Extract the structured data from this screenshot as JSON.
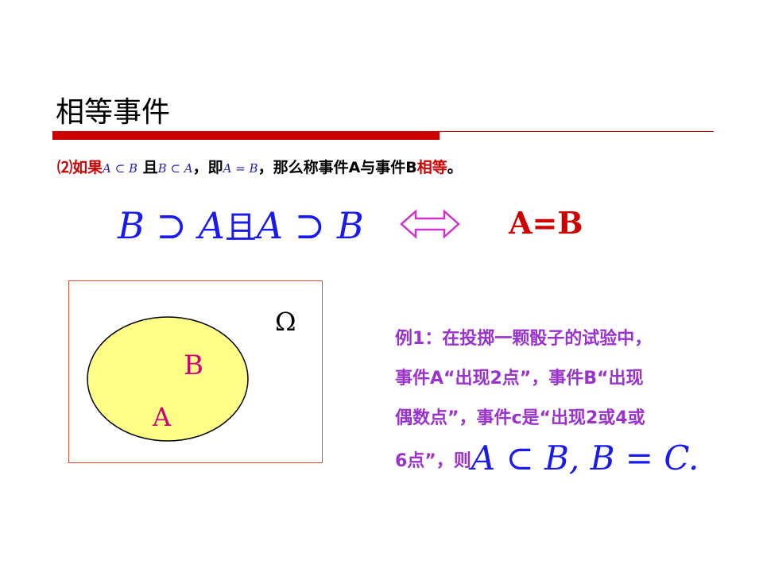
{
  "slide": {
    "title": "相等事件",
    "accent_color": "#cc0000"
  },
  "definition": {
    "prefix": "⑵如果",
    "math1": "A ⊂ B",
    "conj": " 且",
    "math2": "B ⊂ A",
    "mid": "，即",
    "math3": "A = B",
    "suffix": "，那么称事件A与事件B",
    "highlight": "相等",
    "end": "。"
  },
  "formula": {
    "left_part1": "B ⊃ A",
    "left_conj": "且",
    "left_part2": "A ⊃ B",
    "arrow_icon": "double-arrow-icon",
    "right": "A=B"
  },
  "venn": {
    "omega": "Ω",
    "label_b": "B",
    "label_a": "A",
    "fill_color": "#ffff88"
  },
  "example": {
    "line1": "例1：在投掷一颗骰子的试验中，",
    "line2": "事件A“出现2点”，事件B“出现",
    "line3": "偶数点”，事件c是“出现2或4或",
    "line4_prefix": "6点”，则",
    "line4_math": "A ⊂ B, B = C."
  }
}
